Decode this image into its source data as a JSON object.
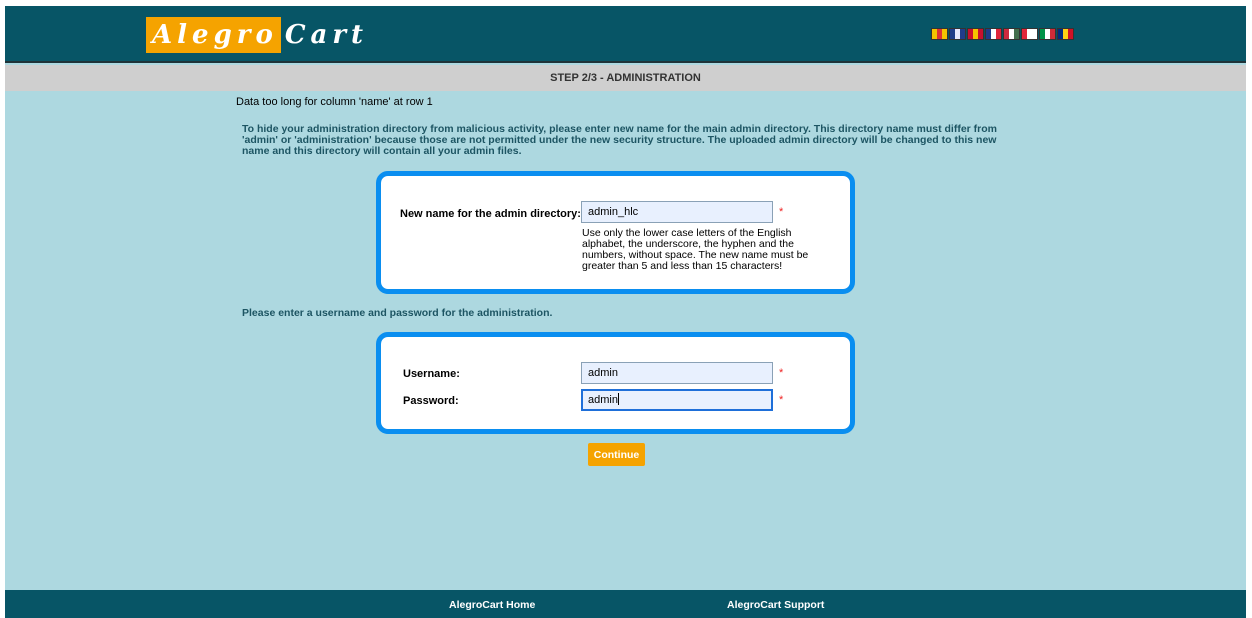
{
  "header": {
    "logo_part1": "Alegro",
    "logo_part2": "Cart",
    "flags": [
      {
        "name": "catalan-flag",
        "colors": [
          "#f5c400",
          "#d33",
          "#f5c400"
        ]
      },
      {
        "name": "uk-flag",
        "colors": [
          "#1f3c8a",
          "#e8e8ff",
          "#1f3c8a"
        ]
      },
      {
        "name": "spain-flag",
        "colors": [
          "#c8102e",
          "#f5c400",
          "#c8102e"
        ]
      },
      {
        "name": "france-flag",
        "colors": [
          "#1f3c8a",
          "#ffffff",
          "#e0253a"
        ]
      },
      {
        "name": "hungary-flag",
        "colors": [
          "#cd2a3e",
          "#ffffff",
          "#436f4d"
        ]
      },
      {
        "name": "indonesia-flag",
        "colors": [
          "#e0253a",
          "#ffffff",
          "#ffffff"
        ]
      },
      {
        "name": "italy-flag",
        "colors": [
          "#009246",
          "#ffffff",
          "#ce2b37"
        ]
      },
      {
        "name": "romania-flag",
        "colors": [
          "#002b7f",
          "#fcd116",
          "#ce1126"
        ]
      }
    ]
  },
  "step_title": "STEP 2/3 - ADMINISTRATION",
  "error_message": "Data too long for column 'name' at row 1",
  "intro_text": "To hide your administration directory from malicious activity, please enter new name for the main admin directory. This directory name must differ from 'admin' or 'administration' because those are not permitted under the new security structure. The uploaded admin directory will be changed to this new name and this directory will contain all your admin files.",
  "admin_dir": {
    "label": "New name for the admin directory:",
    "value": "admin_hlc",
    "required_mark": "*",
    "hint": "Use only the lower case letters of the English alphabet, the underscore, the hyphen and the numbers, without space. The new name must be greater than 5 and less than 15 characters!"
  },
  "credentials_title": "Please enter a username and password for the administration.",
  "username": {
    "label": "Username:",
    "value": "admin",
    "required_mark": "*"
  },
  "password": {
    "label": "Password:",
    "value": "admin",
    "required_mark": "*"
  },
  "continue_label": "Continue",
  "footer": {
    "home_link": "AlegroCart Home",
    "support_link": "AlegroCart Support"
  },
  "colors": {
    "header_bg": "#075566",
    "page_bg": "#add8e0",
    "accent": "#f5a300",
    "box_border": "#0a8ef0"
  }
}
